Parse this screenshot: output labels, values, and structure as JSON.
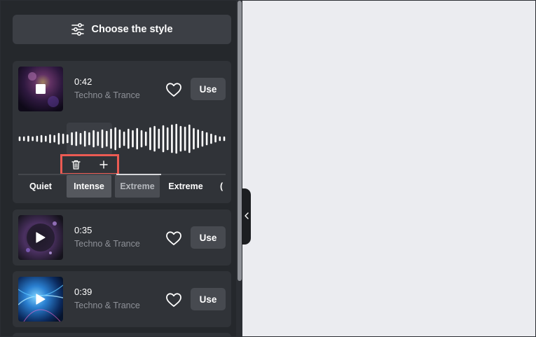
{
  "panel": {
    "style_button": {
      "label": "Choose the style",
      "icon": "sliders-icon"
    }
  },
  "tracks": [
    {
      "duration": "0:42",
      "genre": "Techno & Trance",
      "state": "playing",
      "control_icon": "stop-icon",
      "use_label": "Use",
      "favorite_icon": "heart-outline-icon",
      "expanded": true,
      "segment_tools": {
        "delete_icon": "trash-icon",
        "add_icon": "plus-icon"
      },
      "intensity_options": [
        "Quiet",
        "Intense",
        "Extreme",
        "Extreme",
        "("
      ],
      "intensity_selected": "Intense"
    },
    {
      "duration": "0:35",
      "genre": "Techno & Trance",
      "state": "paused",
      "control_icon": "play-icon",
      "use_label": "Use",
      "favorite_icon": "heart-outline-icon"
    },
    {
      "duration": "0:39",
      "genre": "Techno & Trance",
      "state": "paused",
      "control_icon": "play-icon",
      "use_label": "Use",
      "favorite_icon": "heart-outline-icon"
    }
  ],
  "colors": {
    "panel_bg": "#25282c",
    "card_bg": "#303338",
    "button_bg": "#474a50",
    "highlight_border": "#ec5b53",
    "canvas_bg": "#ebecf0"
  }
}
